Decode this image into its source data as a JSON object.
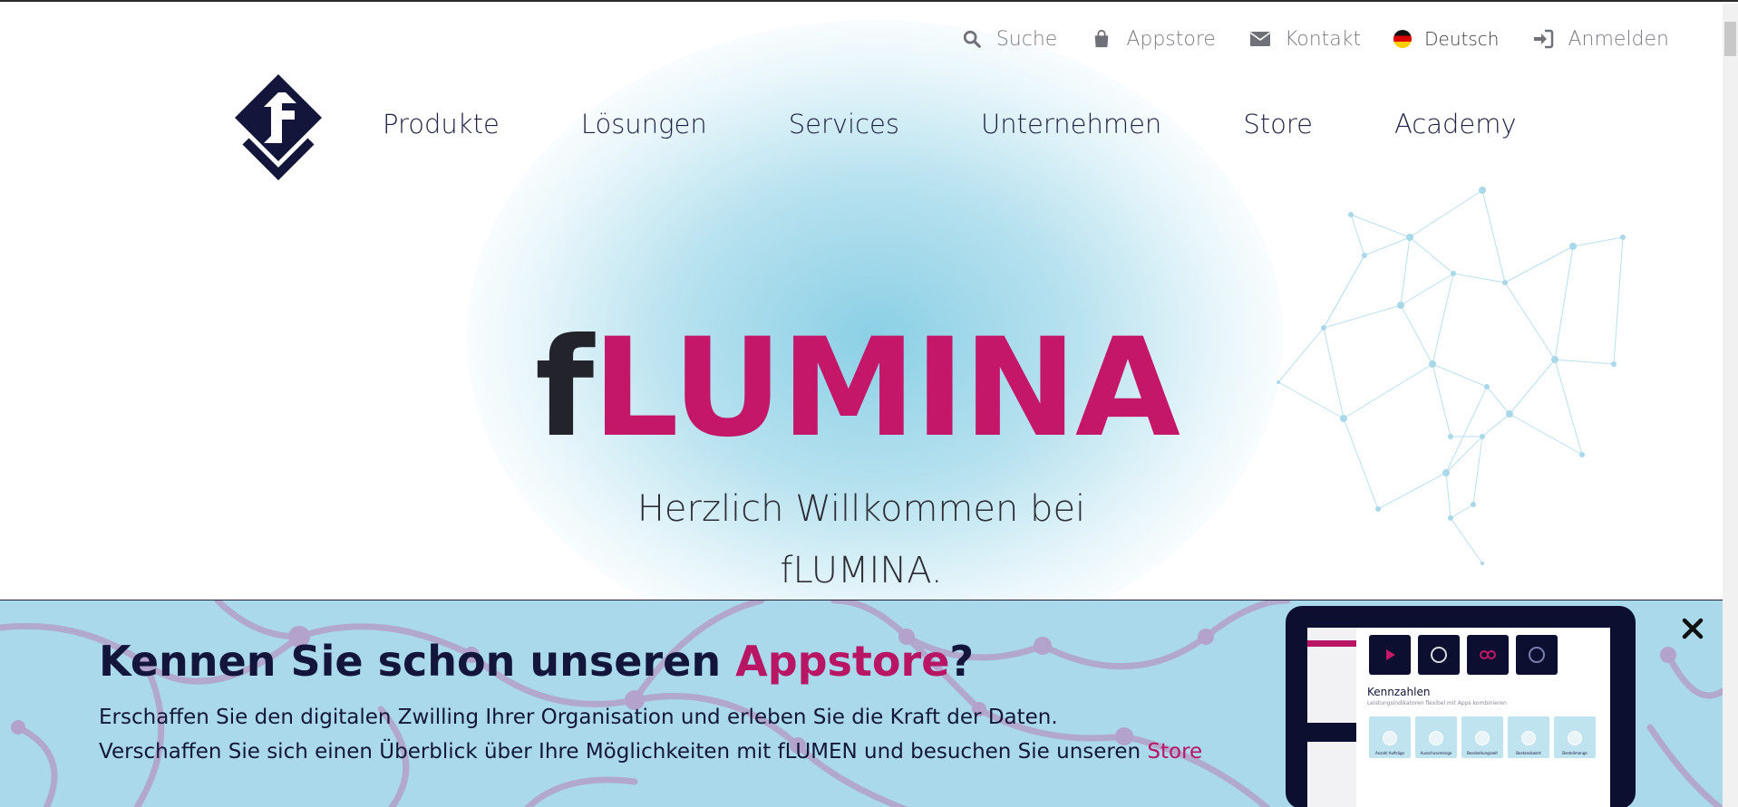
{
  "topbar": {
    "search_label": "Suche",
    "appstore_label": "Appstore",
    "contact_label": "Kontakt",
    "language_label": "Deutsch",
    "login_label": "Anmelden"
  },
  "nav": {
    "items": [
      "Produkte",
      "Lösungen",
      "Services",
      "Unternehmen",
      "Store",
      "Academy"
    ]
  },
  "hero": {
    "title_prefix": "f",
    "title_rest": "LUMINA",
    "subtitle_line1": "Herzlich Willkommen bei",
    "subtitle_line2": "fLUMINA."
  },
  "banner": {
    "heading_part1": "Kennen Sie schon unseren ",
    "heading_accent": "Appstore",
    "heading_part2": "?",
    "text_line1": "Erschaffen Sie den digitalen Zwilling Ihrer Organisation und erleben Sie die Kraft der Daten.",
    "text_line2_prefix": "Verschaffen Sie sich einen Überblick über Ihre Möglichkeiten mit fLUMEN und besuchen Sie unseren ",
    "text_line2_link": "Store"
  },
  "tablet": {
    "heading": "Kennzahlen",
    "subheading": "Leistungsindikatoren flexibel mit Apps kombinieren",
    "cards": [
      "Anzahl Aufträge",
      "Ausschussmenge",
      "Bearbeitungszeit",
      "Bestandswert",
      "Bestellmenge"
    ]
  },
  "colors": {
    "accent": "#c4176a",
    "navy": "#13163a",
    "banner_bg": "#a9d9ea",
    "glow": "#85cde4"
  }
}
